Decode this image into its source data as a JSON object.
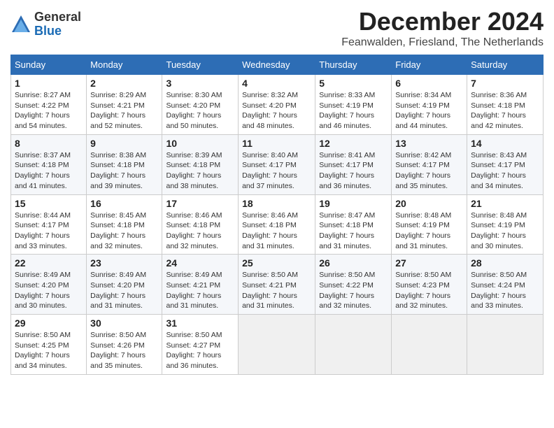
{
  "header": {
    "logo_line1": "General",
    "logo_line2": "Blue",
    "month": "December 2024",
    "location": "Feanwalden, Friesland, The Netherlands"
  },
  "days_of_week": [
    "Sunday",
    "Monday",
    "Tuesday",
    "Wednesday",
    "Thursday",
    "Friday",
    "Saturday"
  ],
  "weeks": [
    [
      {
        "day": "1",
        "sunrise": "8:27 AM",
        "sunset": "4:22 PM",
        "daylight": "7 hours and 54 minutes."
      },
      {
        "day": "2",
        "sunrise": "8:29 AM",
        "sunset": "4:21 PM",
        "daylight": "7 hours and 52 minutes."
      },
      {
        "day": "3",
        "sunrise": "8:30 AM",
        "sunset": "4:20 PM",
        "daylight": "7 hours and 50 minutes."
      },
      {
        "day": "4",
        "sunrise": "8:32 AM",
        "sunset": "4:20 PM",
        "daylight": "7 hours and 48 minutes."
      },
      {
        "day": "5",
        "sunrise": "8:33 AM",
        "sunset": "4:19 PM",
        "daylight": "7 hours and 46 minutes."
      },
      {
        "day": "6",
        "sunrise": "8:34 AM",
        "sunset": "4:19 PM",
        "daylight": "7 hours and 44 minutes."
      },
      {
        "day": "7",
        "sunrise": "8:36 AM",
        "sunset": "4:18 PM",
        "daylight": "7 hours and 42 minutes."
      }
    ],
    [
      {
        "day": "8",
        "sunrise": "8:37 AM",
        "sunset": "4:18 PM",
        "daylight": "7 hours and 41 minutes."
      },
      {
        "day": "9",
        "sunrise": "8:38 AM",
        "sunset": "4:18 PM",
        "daylight": "7 hours and 39 minutes."
      },
      {
        "day": "10",
        "sunrise": "8:39 AM",
        "sunset": "4:18 PM",
        "daylight": "7 hours and 38 minutes."
      },
      {
        "day": "11",
        "sunrise": "8:40 AM",
        "sunset": "4:17 PM",
        "daylight": "7 hours and 37 minutes."
      },
      {
        "day": "12",
        "sunrise": "8:41 AM",
        "sunset": "4:17 PM",
        "daylight": "7 hours and 36 minutes."
      },
      {
        "day": "13",
        "sunrise": "8:42 AM",
        "sunset": "4:17 PM",
        "daylight": "7 hours and 35 minutes."
      },
      {
        "day": "14",
        "sunrise": "8:43 AM",
        "sunset": "4:17 PM",
        "daylight": "7 hours and 34 minutes."
      }
    ],
    [
      {
        "day": "15",
        "sunrise": "8:44 AM",
        "sunset": "4:17 PM",
        "daylight": "7 hours and 33 minutes."
      },
      {
        "day": "16",
        "sunrise": "8:45 AM",
        "sunset": "4:18 PM",
        "daylight": "7 hours and 32 minutes."
      },
      {
        "day": "17",
        "sunrise": "8:46 AM",
        "sunset": "4:18 PM",
        "daylight": "7 hours and 32 minutes."
      },
      {
        "day": "18",
        "sunrise": "8:46 AM",
        "sunset": "4:18 PM",
        "daylight": "7 hours and 31 minutes."
      },
      {
        "day": "19",
        "sunrise": "8:47 AM",
        "sunset": "4:18 PM",
        "daylight": "7 hours and 31 minutes."
      },
      {
        "day": "20",
        "sunrise": "8:48 AM",
        "sunset": "4:19 PM",
        "daylight": "7 hours and 31 minutes."
      },
      {
        "day": "21",
        "sunrise": "8:48 AM",
        "sunset": "4:19 PM",
        "daylight": "7 hours and 30 minutes."
      }
    ],
    [
      {
        "day": "22",
        "sunrise": "8:49 AM",
        "sunset": "4:20 PM",
        "daylight": "7 hours and 30 minutes."
      },
      {
        "day": "23",
        "sunrise": "8:49 AM",
        "sunset": "4:20 PM",
        "daylight": "7 hours and 31 minutes."
      },
      {
        "day": "24",
        "sunrise": "8:49 AM",
        "sunset": "4:21 PM",
        "daylight": "7 hours and 31 minutes."
      },
      {
        "day": "25",
        "sunrise": "8:50 AM",
        "sunset": "4:21 PM",
        "daylight": "7 hours and 31 minutes."
      },
      {
        "day": "26",
        "sunrise": "8:50 AM",
        "sunset": "4:22 PM",
        "daylight": "7 hours and 32 minutes."
      },
      {
        "day": "27",
        "sunrise": "8:50 AM",
        "sunset": "4:23 PM",
        "daylight": "7 hours and 32 minutes."
      },
      {
        "day": "28",
        "sunrise": "8:50 AM",
        "sunset": "4:24 PM",
        "daylight": "7 hours and 33 minutes."
      }
    ],
    [
      {
        "day": "29",
        "sunrise": "8:50 AM",
        "sunset": "4:25 PM",
        "daylight": "7 hours and 34 minutes."
      },
      {
        "day": "30",
        "sunrise": "8:50 AM",
        "sunset": "4:26 PM",
        "daylight": "7 hours and 35 minutes."
      },
      {
        "day": "31",
        "sunrise": "8:50 AM",
        "sunset": "4:27 PM",
        "daylight": "7 hours and 36 minutes."
      },
      null,
      null,
      null,
      null
    ]
  ],
  "labels": {
    "sunrise": "Sunrise:",
    "sunset": "Sunset:",
    "daylight": "Daylight:"
  }
}
